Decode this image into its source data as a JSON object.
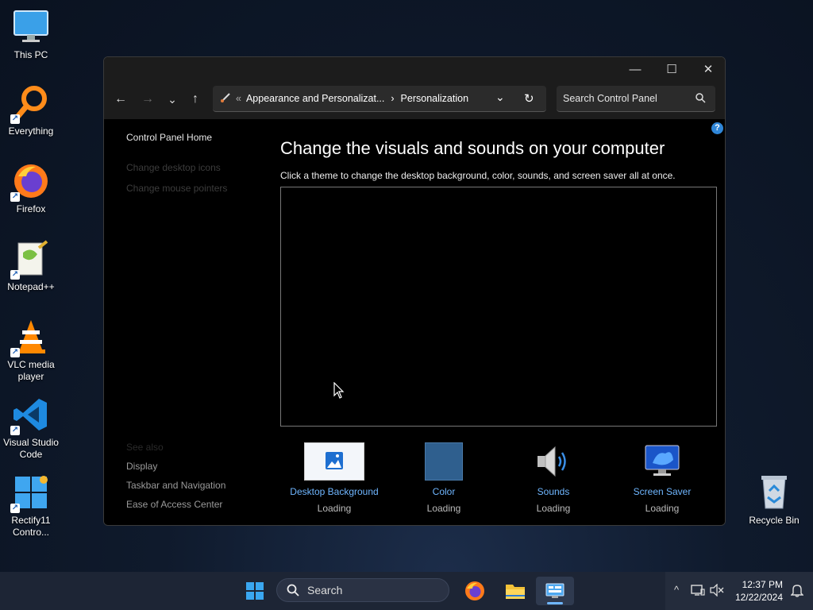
{
  "desktop": {
    "icons": [
      {
        "label": "This PC",
        "icon": "monitor-icon"
      },
      {
        "label": "Everything",
        "icon": "magnifier-icon"
      },
      {
        "label": "Firefox",
        "icon": "firefox-icon"
      },
      {
        "label": "Notepad++",
        "icon": "notepad-plus-plus-icon"
      },
      {
        "label": "VLC media player",
        "icon": "vlc-cone-icon"
      },
      {
        "label": "Visual Studio Code",
        "icon": "vscode-icon"
      },
      {
        "label": "Rectify11 Contro...",
        "icon": "rectify11-icon"
      },
      {
        "label": "Recycle Bin",
        "icon": "recycle-bin-icon"
      }
    ]
  },
  "window": {
    "controls": {
      "minimize": "—",
      "maximize": "☐",
      "close": "✕"
    },
    "nav": {
      "back": "←",
      "forward": "→",
      "recent": "⌄",
      "up": "↑"
    },
    "address": {
      "separator_prefix": "«",
      "crumbs": [
        "Appearance and Personalizat...",
        "Personalization"
      ],
      "crumb_separator": "›",
      "dropdown": "⌄",
      "refresh": "↻"
    },
    "search": {
      "placeholder": "Search Control Panel"
    },
    "left_pane": {
      "home": "Control Panel Home",
      "links": [
        "Change desktop icons",
        "Change mouse pointers"
      ],
      "see_also": "See also",
      "see_also_links": [
        "Display",
        "Taskbar and Navigation",
        "Ease of Access Center"
      ]
    },
    "help": "?",
    "heading": "Change the visuals and sounds on your computer",
    "subtext": "Click a theme to change the desktop background, color, sounds, and screen saver all at once.",
    "tiles": [
      {
        "name": "Desktop Background",
        "status": "Loading",
        "icon": "picture-icon"
      },
      {
        "name": "Color",
        "status": "Loading",
        "icon": "color-swatch-icon"
      },
      {
        "name": "Sounds",
        "status": "Loading",
        "icon": "speaker-icon"
      },
      {
        "name": "Screen Saver",
        "status": "Loading",
        "icon": "screen-saver-monitor-icon"
      }
    ]
  },
  "taskbar": {
    "search_label": "Search",
    "apps": [
      "start-icon",
      "firefox-icon",
      "file-explorer-icon",
      "control-panel-icon"
    ],
    "clock": {
      "time": "12:37 PM",
      "date": "12/22/2024"
    },
    "tray": {
      "chevron": "^"
    }
  },
  "colors": {
    "accent": "#6fb6ff",
    "window_bg": "#000000",
    "titlebar": "#1c1c1c",
    "taskbar": "#1d2535"
  }
}
